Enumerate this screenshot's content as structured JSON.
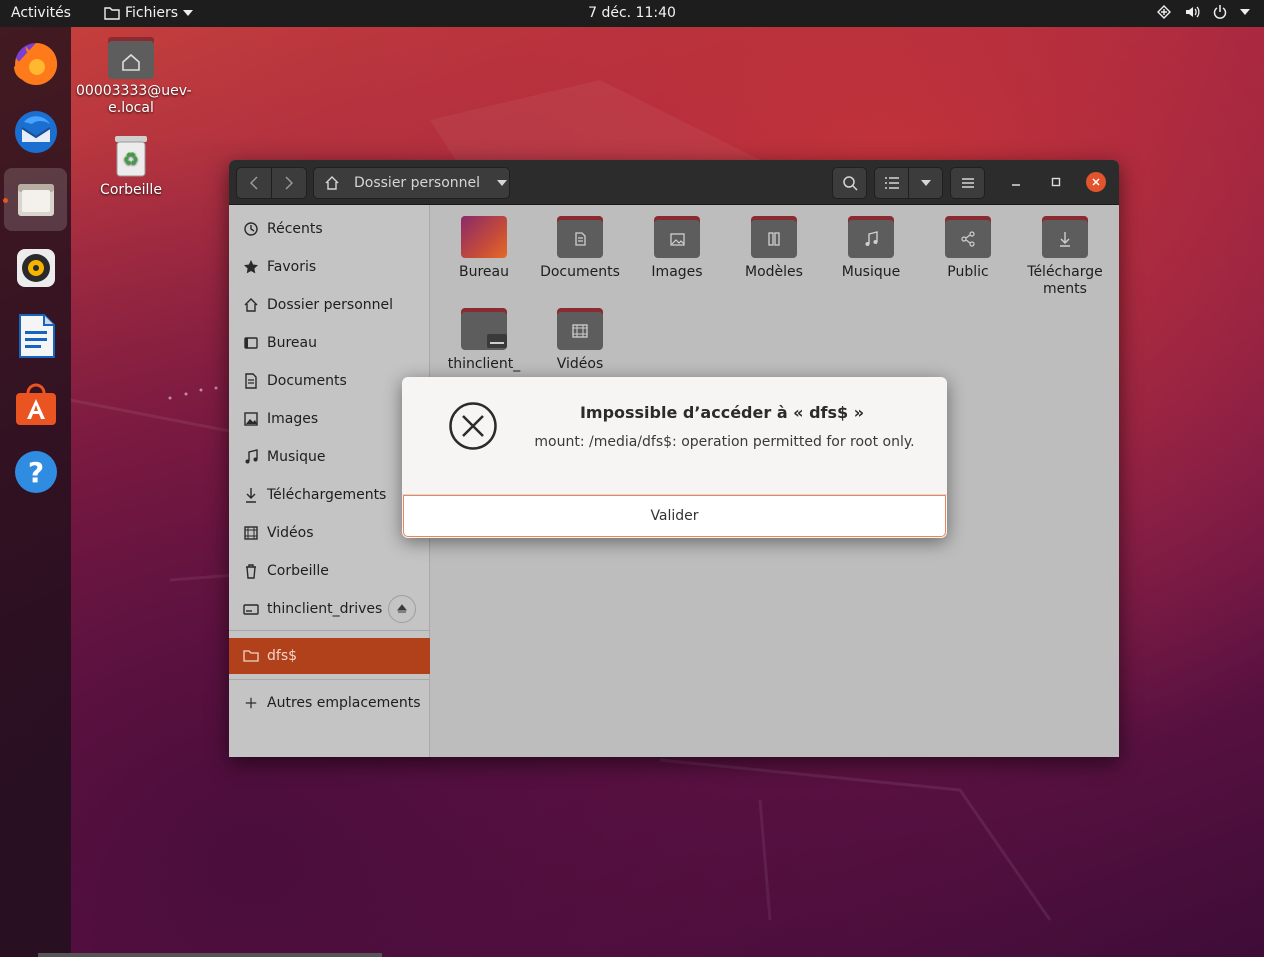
{
  "topbar": {
    "activities": "Activités",
    "app_menu": "Fichiers",
    "clock": "7 déc.  11:40"
  },
  "dock": {
    "items": [
      "firefox",
      "thunderbird",
      "files",
      "rhythmbox",
      "libreoffice-writer",
      "ubuntu-software",
      "help"
    ]
  },
  "desktop": {
    "home_icon_label": "00003333@uev-e.local",
    "trash_icon_label": "Corbeille"
  },
  "window": {
    "path_label": "Dossier personnel",
    "sidebar": {
      "items": [
        {
          "label": "Récents",
          "icon": "clock-icon"
        },
        {
          "label": "Favoris",
          "icon": "star-icon"
        },
        {
          "label": "Dossier personnel",
          "icon": "home-icon"
        },
        {
          "label": "Bureau",
          "icon": "desktop-icon"
        },
        {
          "label": "Documents",
          "icon": "document-icon"
        },
        {
          "label": "Images",
          "icon": "image-icon"
        },
        {
          "label": "Musique",
          "icon": "music-icon"
        },
        {
          "label": "Téléchargements",
          "icon": "download-icon"
        },
        {
          "label": "Vidéos",
          "icon": "video-icon"
        },
        {
          "label": "Corbeille",
          "icon": "trash-icon"
        },
        {
          "label": "thinclient_drives",
          "icon": "drive-icon"
        }
      ],
      "selected": {
        "label": "dfs$",
        "icon": "folder-icon"
      },
      "other_locations": "Autres emplacements"
    },
    "folders": [
      {
        "label": "Bureau",
        "icon": "desktop-folder-icon"
      },
      {
        "label": "Documents",
        "icon": "document-icon"
      },
      {
        "label": "Images",
        "icon": "image-icon"
      },
      {
        "label": "Modèles",
        "icon": "template-icon"
      },
      {
        "label": "Musique",
        "icon": "music-icon"
      },
      {
        "label": "Public",
        "icon": "share-icon"
      },
      {
        "label": "Télécharge ments",
        "icon": "download-icon"
      },
      {
        "label": "thinclient_",
        "icon": "drive-icon"
      },
      {
        "label": "Vidéos",
        "icon": "video-icon"
      }
    ]
  },
  "dialog": {
    "title": "Impossible d’accéder à « dfs$ »",
    "message": "mount: /media/dfs$: operation permitted for root only.",
    "button": "Valider"
  },
  "colors": {
    "accent": "#e95420",
    "selected_sidebar": "#b1411b",
    "folder_tab": "#8a2a31"
  }
}
